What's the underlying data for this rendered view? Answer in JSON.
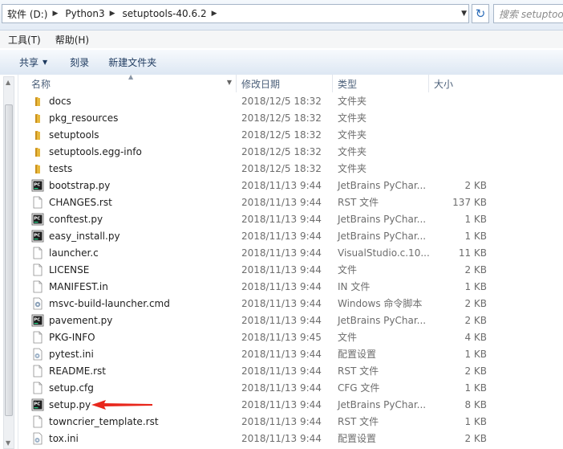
{
  "address": {
    "crumbs": [
      "软件 (D:)",
      "Python3",
      "setuptools-40.6.2"
    ],
    "search_placeholder": "搜索 setuptools"
  },
  "menu": [
    "工具(T)",
    "帮助(H)"
  ],
  "toolbar": {
    "share_label": "共享",
    "burn_label": "刻录",
    "new_folder_label": "新建文件夹"
  },
  "columns": {
    "name": "名称",
    "date": "修改日期",
    "type": "类型",
    "size": "大小"
  },
  "files": [
    {
      "name": "docs",
      "date": "2018/12/5 18:32",
      "type": "文件夹",
      "size": "",
      "icon": "folder-icon"
    },
    {
      "name": "pkg_resources",
      "date": "2018/12/5 18:32",
      "type": "文件夹",
      "size": "",
      "icon": "folder-icon"
    },
    {
      "name": "setuptools",
      "date": "2018/12/5 18:32",
      "type": "文件夹",
      "size": "",
      "icon": "folder-icon"
    },
    {
      "name": "setuptools.egg-info",
      "date": "2018/12/5 18:32",
      "type": "文件夹",
      "size": "",
      "icon": "folder-icon"
    },
    {
      "name": "tests",
      "date": "2018/12/5 18:32",
      "type": "文件夹",
      "size": "",
      "icon": "folder-icon"
    },
    {
      "name": "bootstrap.py",
      "date": "2018/11/13 9:44",
      "type": "JetBrains PyChar...",
      "size": "2 KB",
      "icon": "pycharm-file-icon"
    },
    {
      "name": "CHANGES.rst",
      "date": "2018/11/13 9:44",
      "type": "RST 文件",
      "size": "137 KB",
      "icon": "file-icon"
    },
    {
      "name": "conftest.py",
      "date": "2018/11/13 9:44",
      "type": "JetBrains PyChar...",
      "size": "1 KB",
      "icon": "pycharm-file-icon"
    },
    {
      "name": "easy_install.py",
      "date": "2018/11/13 9:44",
      "type": "JetBrains PyChar...",
      "size": "1 KB",
      "icon": "pycharm-file-icon"
    },
    {
      "name": "launcher.c",
      "date": "2018/11/13 9:44",
      "type": "VisualStudio.c.10...",
      "size": "11 KB",
      "icon": "file-icon"
    },
    {
      "name": "LICENSE",
      "date": "2018/11/13 9:44",
      "type": "文件",
      "size": "2 KB",
      "icon": "file-icon"
    },
    {
      "name": "MANIFEST.in",
      "date": "2018/11/13 9:44",
      "type": "IN 文件",
      "size": "1 KB",
      "icon": "file-icon"
    },
    {
      "name": "msvc-build-launcher.cmd",
      "date": "2018/11/13 9:44",
      "type": "Windows 命令脚本",
      "size": "2 KB",
      "icon": "cmd-script-icon"
    },
    {
      "name": "pavement.py",
      "date": "2018/11/13 9:44",
      "type": "JetBrains PyChar...",
      "size": "2 KB",
      "icon": "pycharm-file-icon"
    },
    {
      "name": "PKG-INFO",
      "date": "2018/11/13 9:45",
      "type": "文件",
      "size": "4 KB",
      "icon": "file-icon"
    },
    {
      "name": "pytest.ini",
      "date": "2018/11/13 9:44",
      "type": "配置设置",
      "size": "1 KB",
      "icon": "settings-file-icon"
    },
    {
      "name": "README.rst",
      "date": "2018/11/13 9:44",
      "type": "RST 文件",
      "size": "2 KB",
      "icon": "file-icon"
    },
    {
      "name": "setup.cfg",
      "date": "2018/11/13 9:44",
      "type": "CFG 文件",
      "size": "1 KB",
      "icon": "file-icon"
    },
    {
      "name": "setup.py",
      "date": "2018/11/13 9:44",
      "type": "JetBrains PyChar...",
      "size": "8 KB",
      "icon": "pycharm-file-icon"
    },
    {
      "name": "towncrier_template.rst",
      "date": "2018/11/13 9:44",
      "type": "RST 文件",
      "size": "1 KB",
      "icon": "file-icon"
    },
    {
      "name": "tox.ini",
      "date": "2018/11/13 9:44",
      "type": "配置设置",
      "size": "2 KB",
      "icon": "settings-file-icon"
    }
  ],
  "colors": {
    "folder": "#e8b93c",
    "pycharm_bg": "#1d1d1d",
    "pycharm_bar": "#21d789",
    "annotation_arrow": "#e8271c"
  }
}
